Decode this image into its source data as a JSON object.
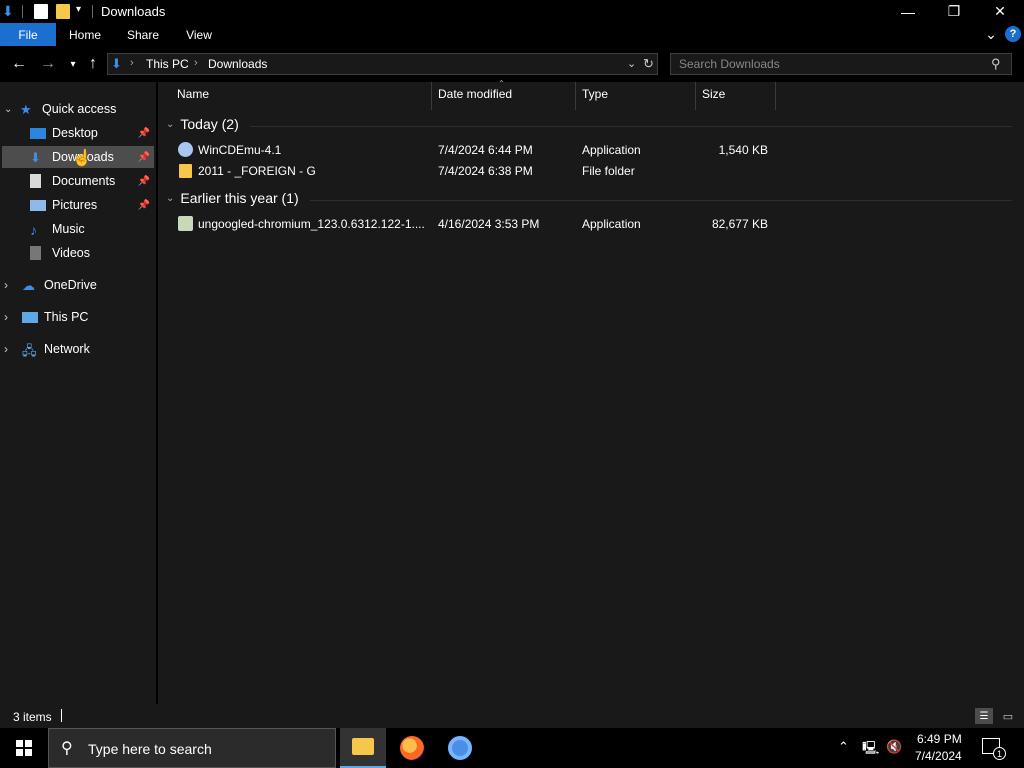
{
  "window": {
    "title": "Downloads",
    "controls": {
      "minimize": "—",
      "maximize": "❐",
      "close": "✕"
    }
  },
  "ribbon": {
    "tabs": [
      "File",
      "Home",
      "Share",
      "View"
    ],
    "help": "?",
    "expand": "⌄"
  },
  "address": {
    "crumbs": [
      "This PC",
      "Downloads"
    ],
    "search_placeholder": "Search Downloads"
  },
  "nav": {
    "quick_access": "Quick access",
    "quick_items": [
      {
        "label": "Desktop",
        "pinned": true
      },
      {
        "label": "Downloads",
        "pinned": true,
        "selected": true
      },
      {
        "label": "Documents",
        "pinned": true
      },
      {
        "label": "Pictures",
        "pinned": true
      },
      {
        "label": "Music",
        "pinned": false
      },
      {
        "label": "Videos",
        "pinned": false
      }
    ],
    "roots": [
      "OneDrive",
      "This PC",
      "Network"
    ]
  },
  "columns": [
    "Name",
    "Date modified",
    "Type",
    "Size"
  ],
  "groups": [
    {
      "label": "Today (2)",
      "rows": [
        {
          "name": "WinCDEmu-4.1",
          "date": "7/4/2024 6:44 PM",
          "type": "Application",
          "size": "1,540 KB",
          "icon": "installer-icon"
        },
        {
          "name": "2011 - _FOREIGN - G",
          "date": "7/4/2024 6:38 PM",
          "type": "File folder",
          "size": "",
          "icon": "folder-icon"
        }
      ]
    },
    {
      "label": "Earlier this year (1)",
      "rows": [
        {
          "name": "ungoogled-chromium_123.0.6312.122-1....",
          "date": "4/16/2024 3:53 PM",
          "type": "Application",
          "size": "82,677 KB",
          "icon": "installer-icon"
        }
      ]
    }
  ],
  "status": {
    "items": "3 items"
  },
  "taskbar": {
    "search_placeholder": "Type here to search",
    "time": "6:49 PM",
    "date": "7/4/2024",
    "notification_count": "1"
  },
  "colors": {
    "accent": "#1a6fcf",
    "pane": "#191919",
    "selected": "#4d4d4d"
  }
}
